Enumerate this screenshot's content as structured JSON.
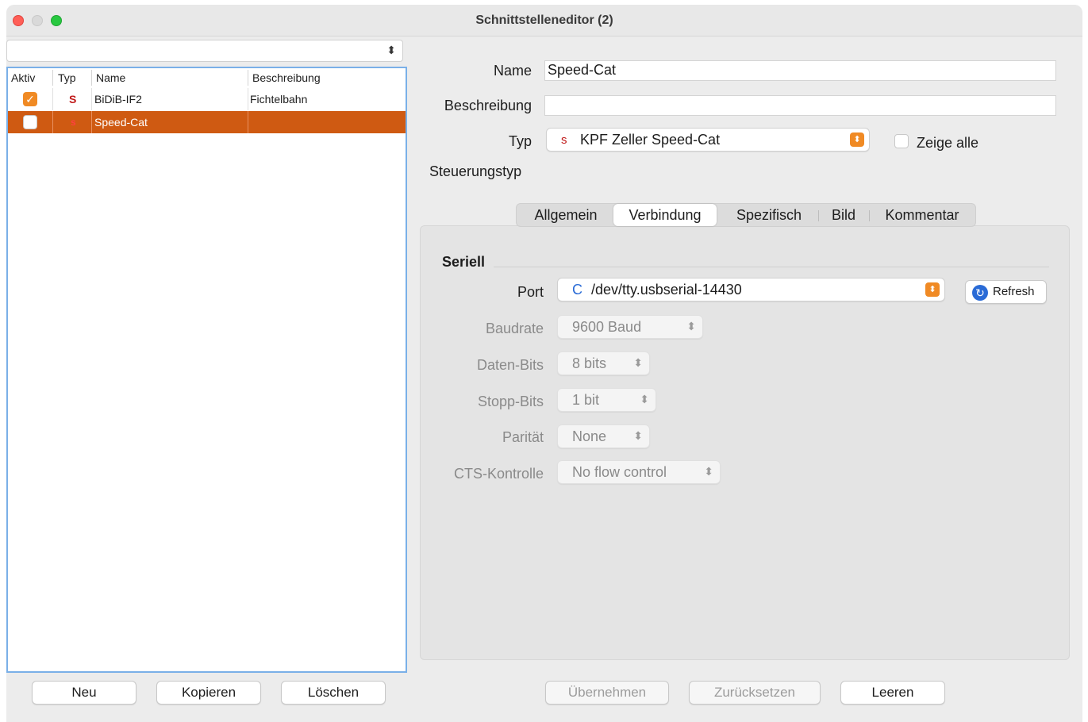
{
  "window": {
    "title": "Schnittstelleneditor (2)"
  },
  "left": {
    "filter_value": "",
    "columns": [
      "Aktiv",
      "Typ",
      "Name",
      "Beschreibung"
    ],
    "rows": [
      {
        "aktiv": true,
        "typ": "S",
        "name": "BiDiB-IF2",
        "beschreibung": "Fichtelbahn",
        "selected": false
      },
      {
        "aktiv": false,
        "typ": "s",
        "name": "Speed-Cat",
        "beschreibung": "",
        "selected": true
      }
    ],
    "buttons": {
      "neu": "Neu",
      "kopieren": "Kopieren",
      "loeschen": "Löschen"
    }
  },
  "form": {
    "name_label": "Name",
    "name_value": "Speed-Cat",
    "beschreibung_label": "Beschreibung",
    "beschreibung_value": "",
    "typ_label": "Typ",
    "typ_prefix": "s",
    "typ_value": "KPF Zeller Speed-Cat",
    "zeige_alle": "Zeige alle",
    "steuerungstyp_label": "Steuerungstyp"
  },
  "tabs": [
    "Allgemein",
    "Verbindung",
    "Spezifisch",
    "Bild",
    "Kommentar"
  ],
  "active_tab": "Verbindung",
  "seriell": {
    "section_title": "Seriell",
    "port_label": "Port",
    "port_prefix": "C",
    "port_value": "/dev/tty.usbserial-14430",
    "refresh_label": "Refresh",
    "baudrate_label": "Baudrate",
    "baudrate_value": "9600 Baud",
    "datenbits_label": "Daten-Bits",
    "datenbits_value": "8 bits",
    "stoppbits_label": "Stopp-Bits",
    "stoppbits_value": "1 bit",
    "paritaet_label": "Parität",
    "paritaet_value": "None",
    "cts_label": "CTS-Kontrolle",
    "cts_value": "No flow control"
  },
  "bottom_buttons": {
    "uebernehmen": "Übernehmen",
    "zuruecksetzen": "Zurücksetzen",
    "leeren": "Leeren"
  },
  "colors": {
    "accent": "#f08a24",
    "selection": "#cf5a12"
  }
}
